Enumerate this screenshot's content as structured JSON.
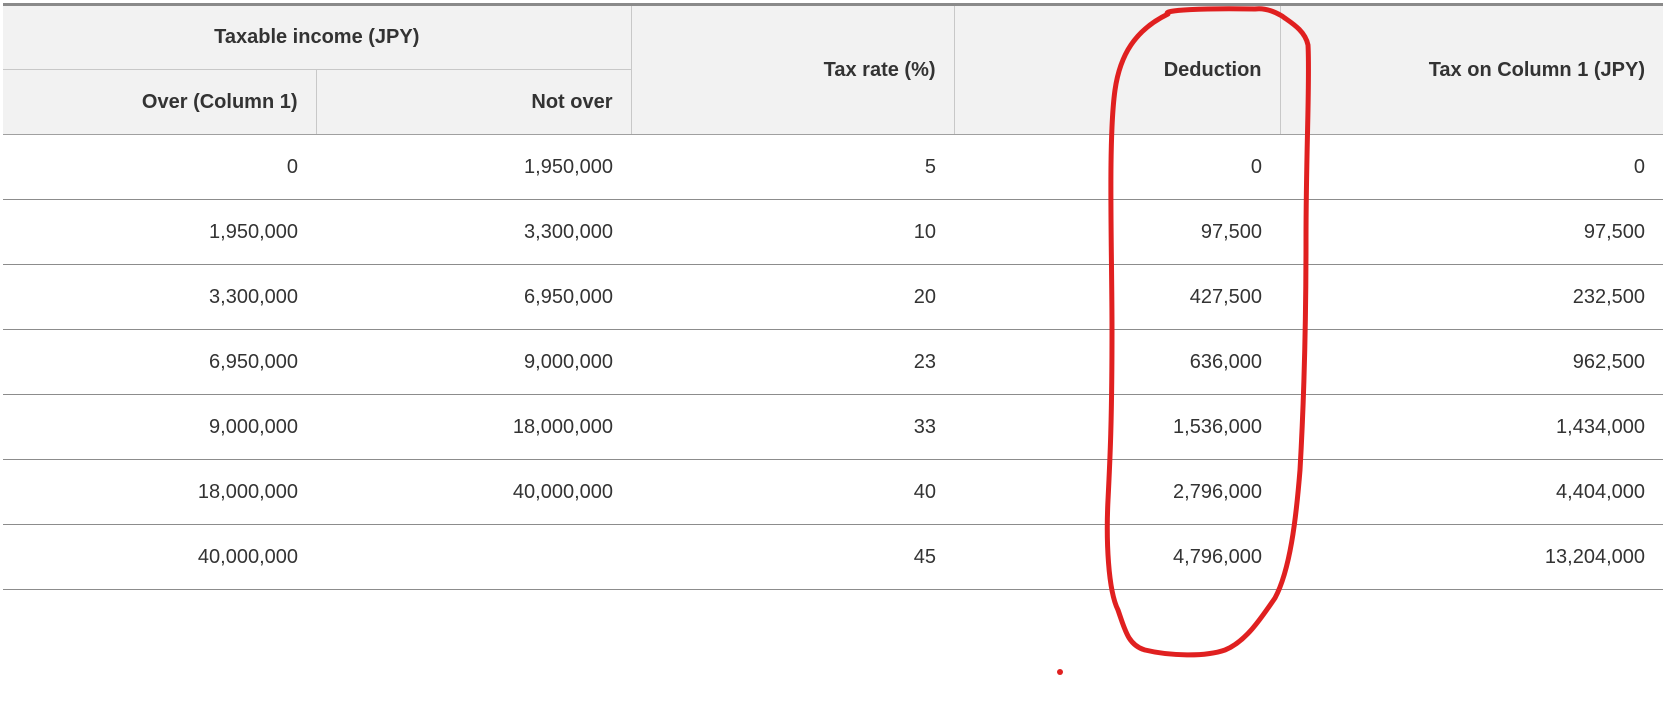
{
  "table": {
    "headers": {
      "taxable_income": "Taxable income (JPY)",
      "over": "Over (Column 1)",
      "not_over": "Not over",
      "tax_rate": "Tax rate (%)",
      "deduction": "Deduction",
      "tax_on_column1": "Tax on Column 1 (JPY)"
    },
    "rows": [
      {
        "over": "0",
        "not_over": "1,950,000",
        "rate": "5",
        "deduction": "0",
        "tax": "0"
      },
      {
        "over": "1,950,000",
        "not_over": "3,300,000",
        "rate": "10",
        "deduction": "97,500",
        "tax": "97,500"
      },
      {
        "over": "3,300,000",
        "not_over": "6,950,000",
        "rate": "20",
        "deduction": "427,500",
        "tax": "232,500"
      },
      {
        "over": "6,950,000",
        "not_over": "9,000,000",
        "rate": "23",
        "deduction": "636,000",
        "tax": "962,500"
      },
      {
        "over": "9,000,000",
        "not_over": "18,000,000",
        "rate": "33",
        "deduction": "1,536,000",
        "tax": "1,434,000"
      },
      {
        "over": "18,000,000",
        "not_over": "40,000,000",
        "rate": "40",
        "deduction": "2,796,000",
        "tax": "4,404,000"
      },
      {
        "over": "40,000,000",
        "not_over": "",
        "rate": "45",
        "deduction": "4,796,000",
        "tax": "13,204,000"
      }
    ]
  },
  "annotation": {
    "stroke_color": "#e02020"
  }
}
